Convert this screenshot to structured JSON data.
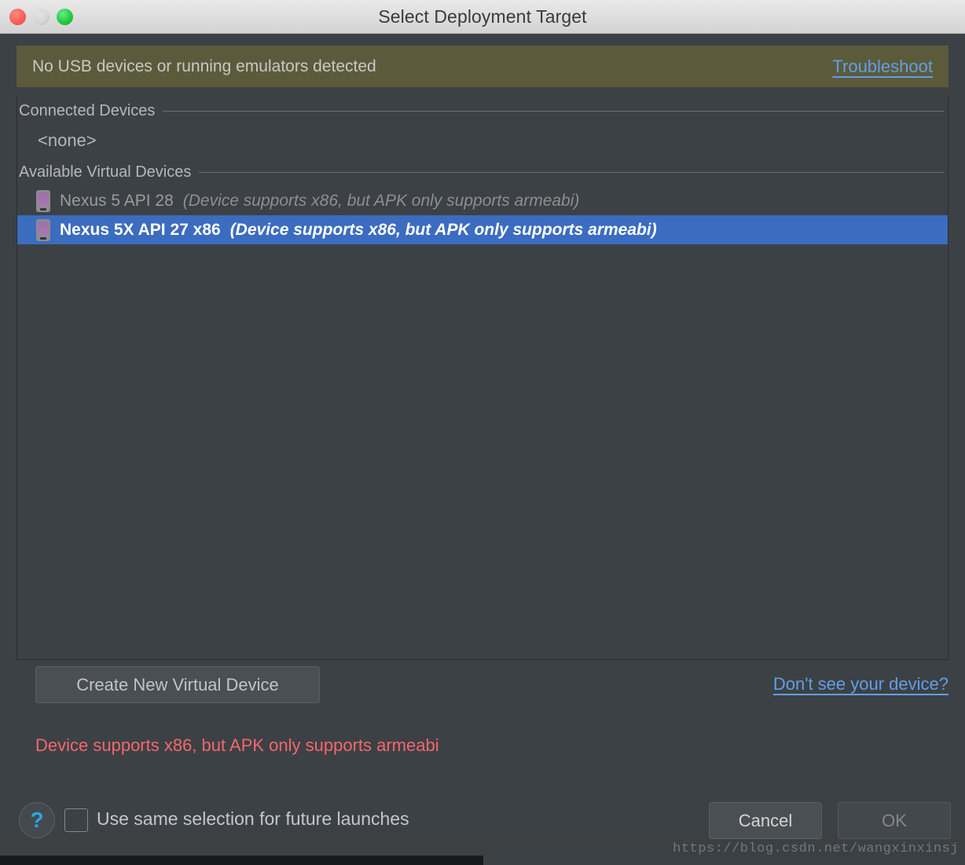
{
  "window": {
    "title": "Select Deployment Target",
    "traffic_lights": [
      "close",
      "minimize",
      "maximize"
    ]
  },
  "warning": {
    "message": "No USB devices or running emulators detected",
    "link_label": "Troubleshoot",
    "background_color": "#5b5b3c",
    "link_color": "#639ee4"
  },
  "groups": [
    {
      "label": "Connected Devices",
      "empty_label": "<none>",
      "devices": []
    },
    {
      "label": "Available Virtual Devices",
      "devices": [
        {
          "name": "Nexus 5 API 28",
          "note": "(Device supports x86, but APK only supports armeabi)",
          "selected": false,
          "icon": "phone-icon"
        },
        {
          "name": "Nexus 5X API 27 x86",
          "note": "(Device supports x86, but APK only supports armeabi)",
          "selected": true,
          "icon": "phone-icon"
        }
      ]
    }
  ],
  "actions": {
    "create_device_label": "Create New Virtual Device",
    "dont_see_device_label": "Don't see your device?"
  },
  "error": {
    "message": "Device supports x86, but APK only supports armeabi",
    "color": "#f4676b"
  },
  "footer": {
    "help_glyph": "?",
    "checkbox_label": "Use same selection for future launches",
    "checkbox_checked": false,
    "cancel_label": "Cancel",
    "ok_label": "OK",
    "ok_enabled": false
  },
  "watermark": {
    "text": "https://blog.csdn.net/wangxinxinsj"
  },
  "colors": {
    "selection_blue": "#3b6cbf",
    "dialog_background": "#3c4145",
    "titlebar_text": "#3a3a3a"
  }
}
